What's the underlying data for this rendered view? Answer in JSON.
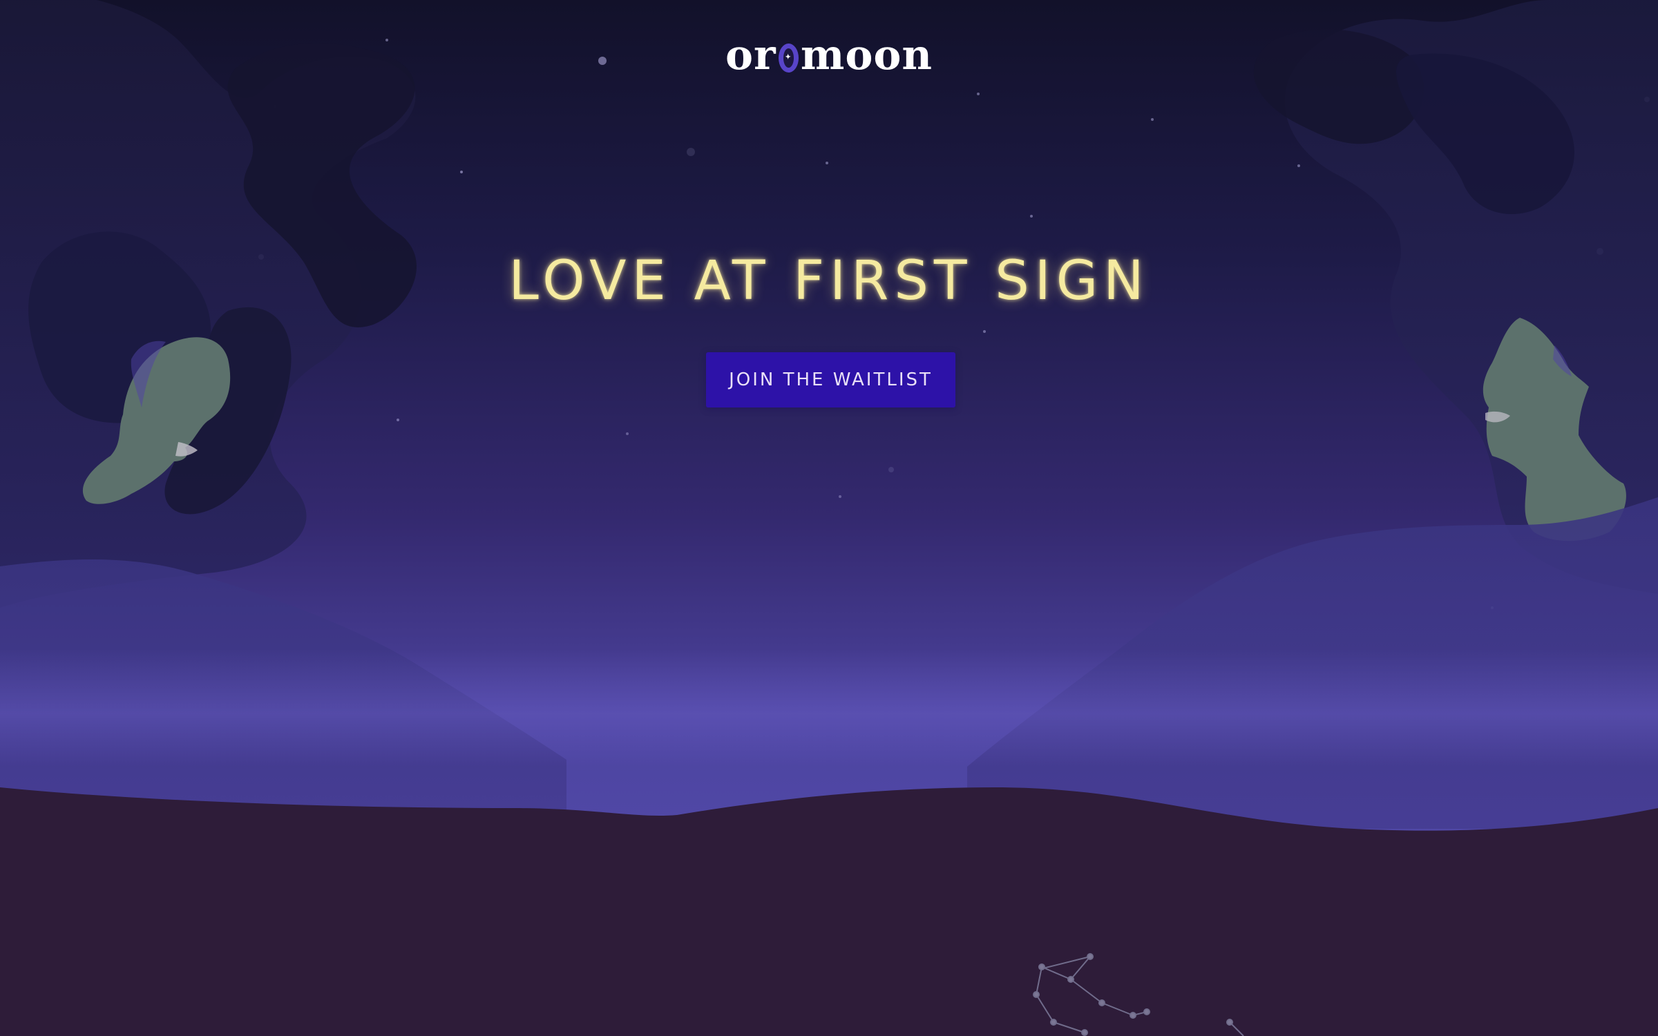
{
  "brand": {
    "logo_before": "or",
    "logo_after": "moon",
    "logo_accent_color": "#5844c8"
  },
  "hero": {
    "title": "LOVE AT FIRST SIGN",
    "title_color": "#f5eaa0",
    "cta_label": "JOIN THE WAITLIST",
    "cta_color": "#2d12a8"
  },
  "colors": {
    "sky_top": "#12112a",
    "sky_bottom": "#5048a6",
    "ground": "#2e1c39",
    "face": "#5c716c"
  },
  "icons": [
    "woman-face-illustration",
    "man-face-illustration",
    "constellation-icon",
    "star-dot-icon"
  ]
}
